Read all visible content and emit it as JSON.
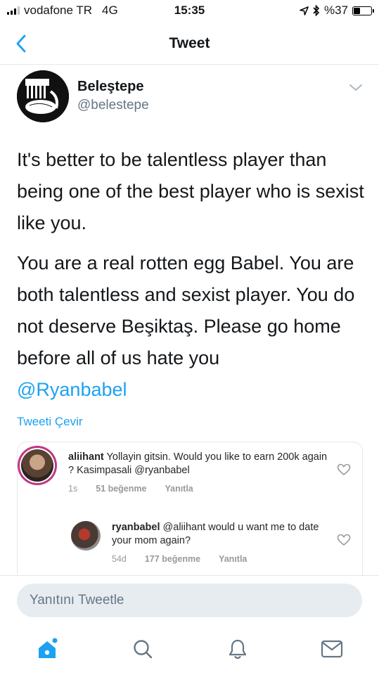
{
  "status_bar": {
    "carrier": "vodafone TR",
    "network": "4G",
    "time": "15:35",
    "battery_text": "%37",
    "battery_level": 0.37
  },
  "nav": {
    "title": "Tweet",
    "back_icon": "chevron-left-icon"
  },
  "tweet": {
    "author_name": "Beleştepe",
    "author_handle": "@belestepe",
    "paragraph_1": "It's better to be talentless player than being one of the best player who is sexist like you.",
    "paragraph_2": "You are a real rotten egg Babel. You are both talentless and sexist player. You do not deserve Beşiktaş. Please go home before all of us hate you",
    "mention": "@Ryanbabel",
    "translate_label": "Tweeti Çevir"
  },
  "embedded": {
    "comments": [
      {
        "user": "aliihant",
        "text": "Yollayin gitsin. Would you like to earn 200k again ? Kasimpasali @ryanbabel",
        "time": "1s",
        "likes": "51 beğenme",
        "reply": "Yanıtla"
      },
      {
        "user": "ryanbabel",
        "text": "@aliihant would u want me to date your mom again?",
        "time": "54d",
        "likes": "177 beğenme",
        "reply": "Yanıtla"
      }
    ]
  },
  "reply": {
    "placeholder": "Yanıtını Tweetle"
  },
  "tab_bar": {
    "items": [
      "home-icon",
      "search-icon",
      "notifications-icon",
      "messages-icon"
    ],
    "accent": "#1da1f2"
  },
  "colors": {
    "accent": "#1da1f2",
    "text": "#14171a",
    "secondary": "#657786"
  }
}
